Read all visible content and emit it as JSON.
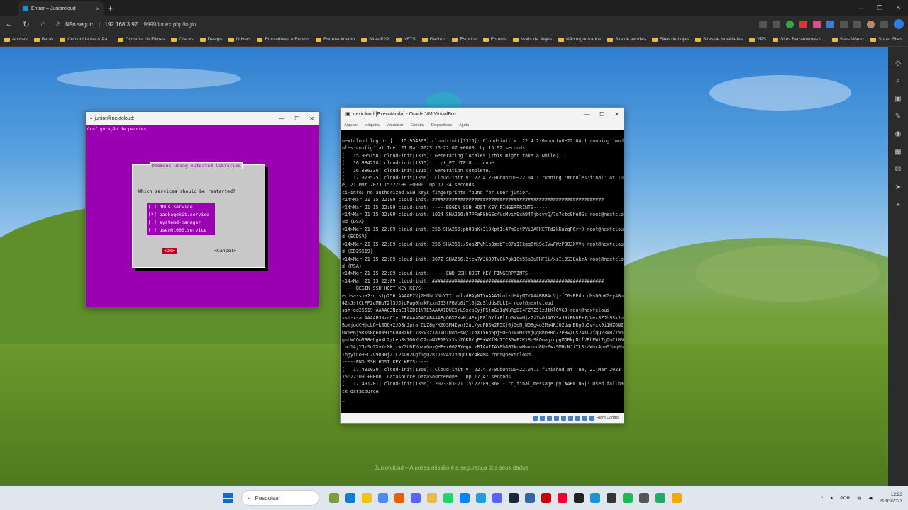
{
  "browser": {
    "tab_title": "Entrar – Juniorcloud",
    "tab_close": "×",
    "new_tab": "+",
    "not_secure_label": "Não seguro",
    "url_host": "192.168.3.97",
    "url_path": ":9999/index.php/login",
    "win_minimize": "—",
    "win_restore": "❐",
    "win_close": "✕",
    "bookmarks": [
      "Animes",
      "Betas",
      "Comunidades & Pa...",
      "Consulta de Filmes",
      "Cracks",
      "Design",
      "Drivers",
      "Emuladores e Rooms",
      "Entretenimento",
      "Sites P2P",
      "NFTS",
      "Ganhos",
      "Estudos",
      "Forums",
      "Mods de Jogos",
      "Não organizados",
      "Site de vendas",
      "Sites de Lojas",
      "Sites de Novidades",
      "VPS",
      "Sites Ferramentas s...",
      "Sites Warez",
      "Super Sites"
    ]
  },
  "terminal": {
    "title": "junior@nextcloud: ~",
    "header": "Configuração de pacotes",
    "dialog_title": "Daemons using outdated libraries",
    "question": "Which services should be restarted?",
    "services": [
      "[ ] dbus.service",
      "[*] packagekit.service",
      "[ ] systemd-manager",
      "[ ] user@1000.service"
    ],
    "ok": "<Ok>",
    "cancel": "<Cancel>"
  },
  "vbox": {
    "title": "nextcloud [Executando] - Oracle VM VirtualBox",
    "menu": [
      "Arquivo",
      "Máquina",
      "Visualizar",
      "Entrada",
      "Dispositivos",
      "Ajuda"
    ],
    "right_control": "Right Control",
    "console_lines": [
      "nextcloud login: [   15.954303] cloud-init[1315]: Cloud-init v. 22.4.2-0ubuntu0~22.04.1 running 'mod",
      "ules:config' at Tue, 21 Mar 2023 15:22:07 +0000. Up 15.92 seconds.",
      "[   15.995150] cloud-init[1315]: Generating locales (this might take a while)...",
      "[   16.884278] cloud-init[1315]:   pt_PT.UTF-8... done",
      "[   16.886330] cloud-init[1315]: Generation complete.",
      "[   17.373575] cloud-init[1356]: Cloud-init v. 22.4.2-0ubuntu0~22.04.1 running 'modules:final' at Tu",
      "e, 21 Mar 2023 15:22:09 +0000. Up 17.34 seconds.",
      "ci-info: no authorized SSH keys fingerprints found for user junior.",
      "<14>Mar 21 15:22:09 cloud-init: #############################################################",
      "<14>Mar 21 15:22:09 cloud-init: -----BEGIN SSH HOST KEY FINGERPRINTS-----",
      "<14>Mar 21 15:22:09 cloud-init: 1024 SHA256:97PFaF0bGEc4VcMvih9xh94TjbcyvQ/7d7ctc0he8Gs root@nextclo",
      "ud (DSA)",
      "<14>Mar 21 15:22:09 cloud-init: 256 SHA256:ph00aK+310Xpt1i47m0cfPVi3AFKETTd2kKazqF6rf0 root@nextclou",
      "d (ECDSA)",
      "<14>Mar 21 15:22:09 cloud-init: 256 SHA256:/Sop2PvM1o3msbTcQ7sIIkqq6fkSeIvwFWzPOOJXVVk root@nextclou",
      "d (ED25519)",
      "<14>Mar 21 15:22:09 cloud-init: 3072 SHA256:2tcw7WJ6B0TvC6Pgk1Cs55a3uFHFIi/xzIiDS3QAkzA root@nextclou",
      "d (RSA)",
      "<14>Mar 21 15:22:09 cloud-init: -----END SSH HOST KEY FINGERPRINTS-----",
      "<14>Mar 21 15:22:09 cloud-init: #############################################################",
      "-----BEGIN SSH HOST KEY KEYS-----",
      "ecdsa-sha2-nistp256 AAAAE2VjZHNhLXNoYTItbmlzdHAyNTYAAAAIbmlzdHAyNTYAAABBBAcVjzfC6sBEdbcdMs0GpKG+yABu",
      "42nJstCtFP2uMHbT2l5JJjoPug0hmkPxxnJ53tFBVb0iYl5j2qSlddsGUkI= root@nextcloud",
      "ssh-ed25519 AAAAC3NzaC1lZDI1NTE5AAAAIDUE5rLSxcoEyjPSjmGs1qWuRgDI4FZR251zJtKl6VGQ root@nextcloud",
      "ssh-rsa AAAAB3NzaC1yc2EAAAADAQABAAABgQDX2XvNj4FxjF8lDYfxFl1hGvVwUjzZiZ40JAGYSaJ9iBN8E+7gVex8ZJh9Sk1u",
      "BoYjodCHjcLQ+kSQQ+2JD8nJprarCLZ8g/K0O3M4Iynt2uL/yuPDSw2P5Xj0jGeNjWG8g4o2Ma4RJ02UanERgOp5v+xk9i1HZ6NI",
      "Ox6e6j9kKsBg6UN915K0NRzkkIT89v3zJa7VU1DooEsw/11nXIx6n5pj9OEoJV+McVYjQqBhm8RdZ2P3w/Qs24KuZfqQ23xH2Y95",
      "gnLWCOmR38eLgnXL2/Leu8s7G0XhO2cuNXF1EXvXsbZOKU/qF9+WKfMd77C3GVP2K1Bn9kQmagrcpgMDRkpNrfVRhEWiTgQnC1HN",
      "tmU1AjYJmSoZXvYrMkjzw/ZLDFVozxQoyQHE+xG028YeguLzRIAuIIAY8h4BJkcwHuvmud8U+Ewz9MHrNJiTL3taWmc4paSJoq6b",
      "TbgyiCoREC2v9890jZICVsOK2KgfTgQ28T1Iv4VXbnQnCNZ4k4M= root@nextcloud",
      "-----END SSH HOST KEY KEYS-----",
      "[   17.491030] cloud-init[1356]: Cloud-init v. 22.4.2-0ubuntu0~22.04.1 finished at Tue, 21 Mar 2023",
      "15:22:09 +0000. Datasource DataSourceNone.  Up 17.47 seconds",
      "[   17.491201] cloud-init[1356]: 2023-03-21 15:22:09,360 - cc_final_message.py[WARNING]: Used fallba",
      "ck datasource",
      "_"
    ]
  },
  "desktop": {
    "caption": "Juniorcloud – A nossa missão é a segurança dos seus dados"
  },
  "taskbar": {
    "search_label": "Pesquisar",
    "lang": "POR",
    "time": "12:23",
    "date": "21/03/2023"
  },
  "colors": {
    "terminal_bg": "#9b00b3",
    "dialog_bg": "#c8c8c8",
    "ok_button": "#c00020",
    "folder": "#e9b949"
  }
}
